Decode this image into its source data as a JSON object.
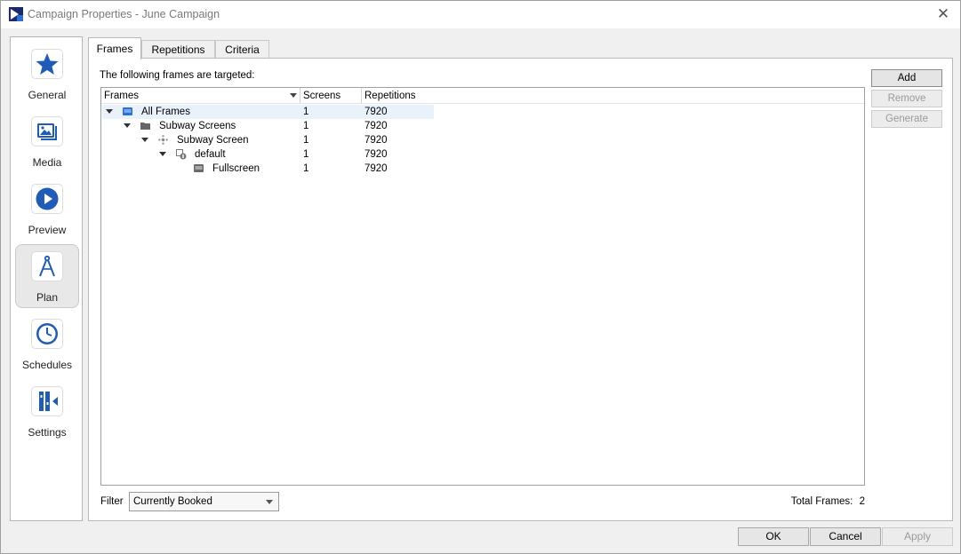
{
  "window": {
    "title": "Campaign Properties - June Campaign",
    "close_glyph": "✕"
  },
  "nav": {
    "items": [
      {
        "label": "General",
        "icon": "star-icon"
      },
      {
        "label": "Media",
        "icon": "media-icon"
      },
      {
        "label": "Preview",
        "icon": "play-icon"
      },
      {
        "label": "Plan",
        "icon": "compass-icon",
        "selected": true
      },
      {
        "label": "Schedules",
        "icon": "clock-icon"
      },
      {
        "label": "Settings",
        "icon": "settings-icon"
      }
    ]
  },
  "tabs": {
    "frames": "Frames",
    "repetitions": "Repetitions",
    "criteria": "Criteria"
  },
  "panel": {
    "caption": "The following frames are targeted:",
    "columns": {
      "frames": "Frames",
      "screens": "Screens",
      "repetitions": "Repetitions"
    },
    "rows": [
      {
        "name": "All Frames",
        "screens": "1",
        "repetitions": "7920",
        "icon": "frame-icon"
      },
      {
        "name": "Subway Screens",
        "screens": "1",
        "repetitions": "7920",
        "icon": "folder-icon"
      },
      {
        "name": "Subway Screen",
        "screens": "1",
        "repetitions": "7920",
        "icon": "network-icon"
      },
      {
        "name": "default",
        "screens": "1",
        "repetitions": "7920",
        "icon": "layout-icon"
      },
      {
        "name": "Fullscreen",
        "screens": "1",
        "repetitions": "7920",
        "icon": "frame-icon"
      }
    ],
    "filter_label": "Filter",
    "filter_value": "Currently Booked",
    "total_label": "Total Frames:",
    "total_value": "2"
  },
  "side_buttons": {
    "add": "Add",
    "remove": "Remove",
    "generate": "Generate"
  },
  "footer": {
    "ok": "OK",
    "cancel": "Cancel",
    "apply": "Apply"
  },
  "colors": {
    "accent": "#1f5bb8",
    "selection": "#e9f2fb"
  }
}
